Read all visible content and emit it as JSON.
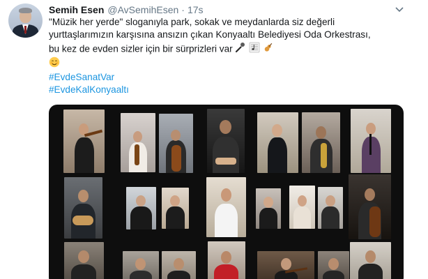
{
  "tweet": {
    "author_name": "Semih Esen",
    "author_handle": "@AvSemihEsen",
    "separator": "·",
    "timestamp": "17s",
    "lines": [
      "\"Müzik her yerde\" sloganıyla park, sokak ve meydanlarda siz değerli",
      "yurttaşlarımızın karşısına ansızın çıkan Konyaaltı Belediyesi Oda Orkestrası,",
      "bu kez de evden sizler için bir sürprizleri var"
    ],
    "hashtags": [
      "#EvdeSanatVar",
      "#EvdeKalKonyaaltı"
    ],
    "icons": [
      "microphone-icon",
      "sheet-music-icon",
      "violin-icon",
      "smiling-face-icon",
      "chevron-down-icon"
    ],
    "colors": {
      "hashtag": "#1b95e0",
      "secondary_text": "#657786",
      "primary_text": "#14171a",
      "media_background": "#0e0e0e"
    }
  }
}
